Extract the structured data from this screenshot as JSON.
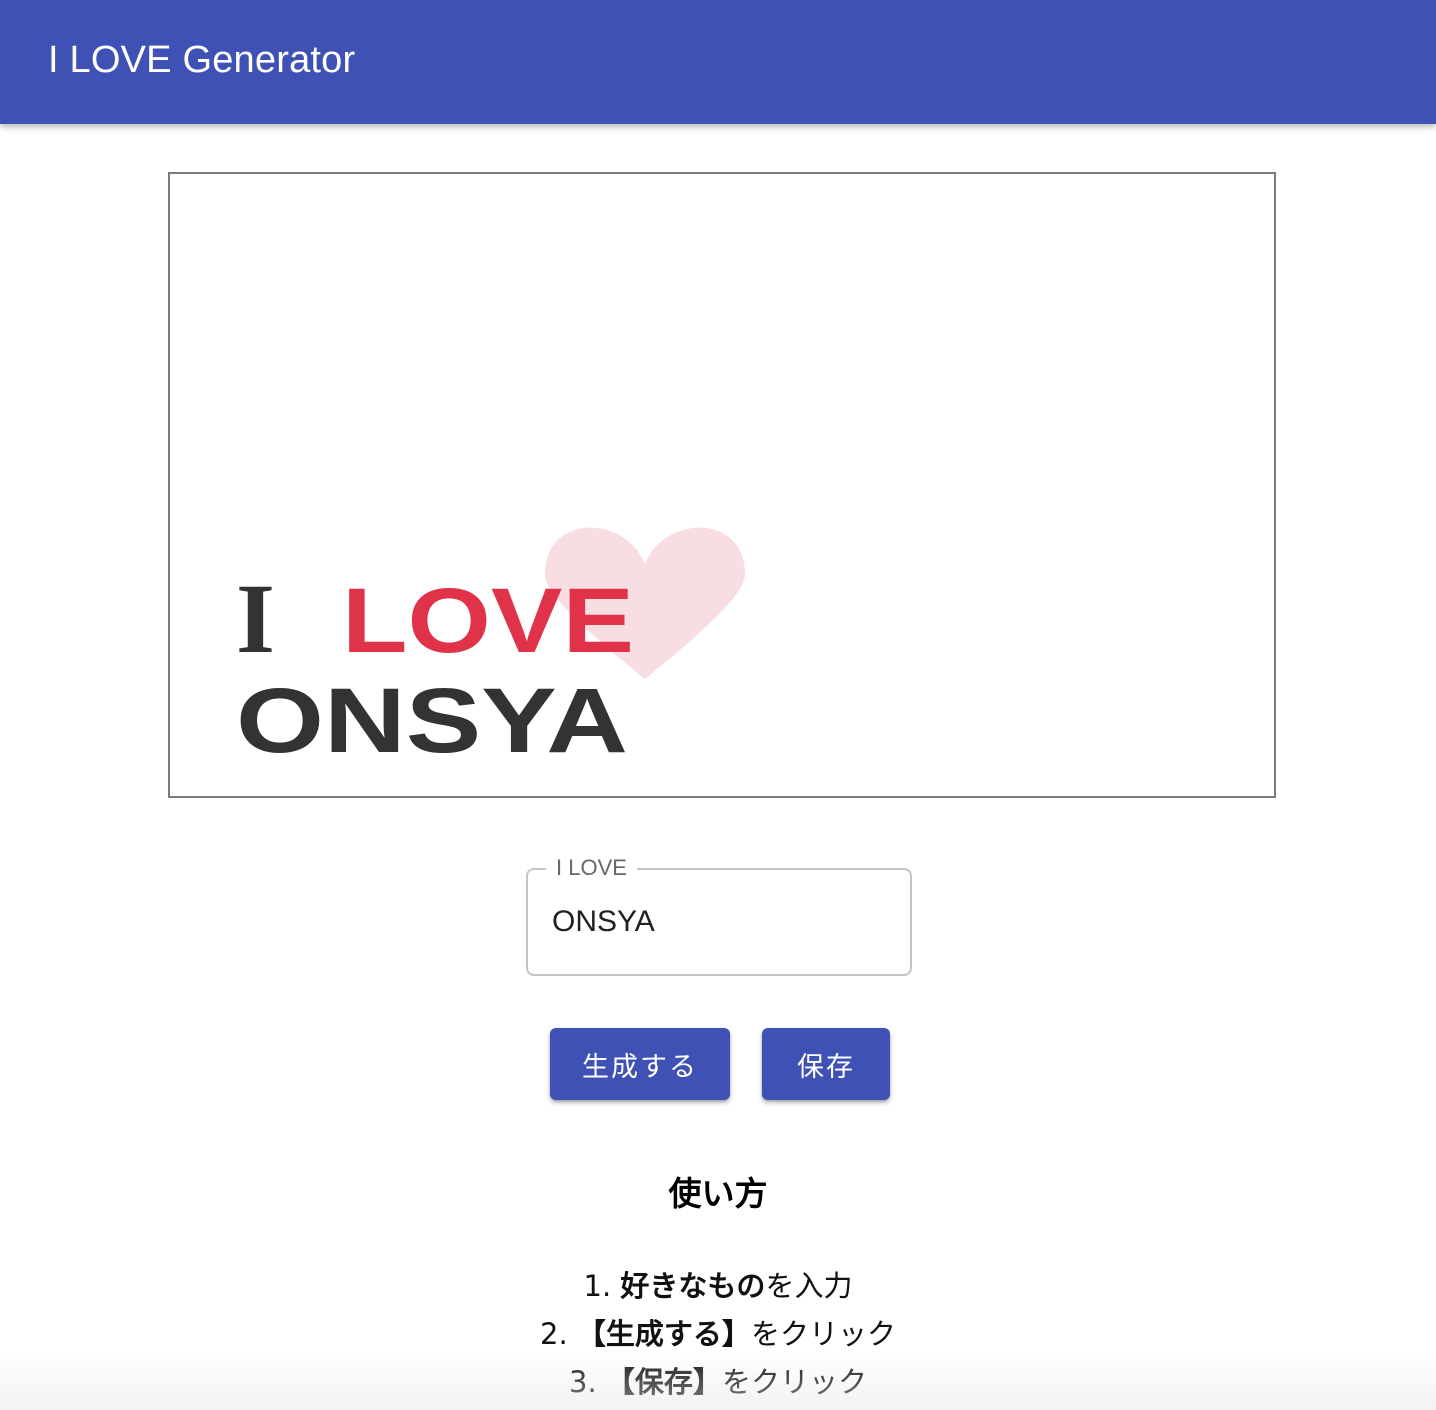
{
  "appbar": {
    "title": "I LOVE Generator",
    "color": "#3f51b5"
  },
  "preview": {
    "word_i": "I",
    "word_love": "LOVE",
    "subject": "ONSYA",
    "love_color": "#e0334a",
    "text_color": "#333333",
    "heart_color": "#f8dde2",
    "decoration": "heart-icon"
  },
  "field": {
    "label": "I LOVE",
    "value": "ONSYA"
  },
  "buttons": {
    "generate": "生成する",
    "save": "保存"
  },
  "howto": {
    "title": "使い方",
    "steps": [
      {
        "num": "1.",
        "bold": "好きなもの",
        "rest": "を入力"
      },
      {
        "num": "2.",
        "bold": "【生成する】",
        "rest": "をクリック"
      },
      {
        "num": "3.",
        "bold": "【保存】",
        "rest": "をクリック"
      }
    ]
  }
}
